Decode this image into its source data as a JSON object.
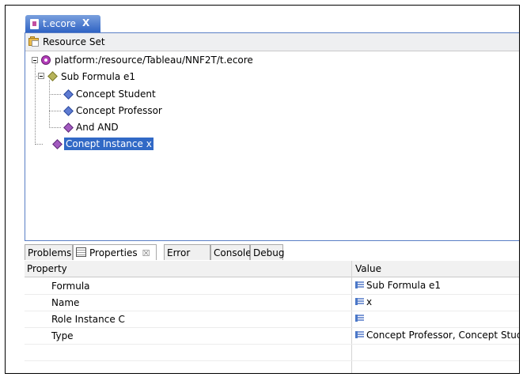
{
  "editor_tab": {
    "label": "t.ecore",
    "icon": "ecore-file-icon",
    "close": "X"
  },
  "resource_set": {
    "title": "Resource Set",
    "icon": "resource-set-folder-icon"
  },
  "tree": {
    "root": {
      "label": "platform:/resource/Tableau/NNF2T/t.ecore",
      "icon": "ecore-package-icon"
    },
    "sub_formula": {
      "label": "Sub Formula e1",
      "icon": "class-diamond-icon"
    },
    "children": [
      {
        "label": "Concept Student",
        "icon": "class-diamond-icon"
      },
      {
        "label": "Concept Professor",
        "icon": "class-diamond-icon"
      },
      {
        "label": "And AND",
        "icon": "class-diamond-icon"
      }
    ],
    "selected": {
      "label": "Conept Instance x",
      "icon": "class-diamond-icon"
    }
  },
  "bottom_tabs": [
    {
      "label": "Problems"
    },
    {
      "label": "Properties",
      "active": true,
      "close": "☒"
    },
    {
      "label": "Error Log"
    },
    {
      "label": "Console"
    },
    {
      "label": "Debug"
    }
  ],
  "properties": {
    "header_property": "Property",
    "header_value": "Value",
    "rows": [
      {
        "name": "Formula",
        "value": "Sub Formula e1"
      },
      {
        "name": "Name",
        "value": "x"
      },
      {
        "name": "Role Instance C",
        "value": ""
      },
      {
        "name": "Type",
        "value": "Concept Professor, Concept Student"
      }
    ]
  },
  "colors": {
    "tab_active": "#2f63c4",
    "selection": "#3169c6",
    "package": "#b23cb8"
  }
}
